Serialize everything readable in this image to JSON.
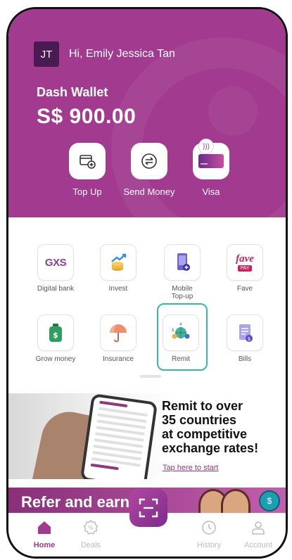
{
  "colors": {
    "brand": "#a23a8f",
    "accent_teal": "#39b8a1",
    "muted": "#bbbbbb"
  },
  "user": {
    "initials": "JT",
    "greeting": "Hi, Emily Jessica Tan"
  },
  "wallet": {
    "label": "Dash Wallet",
    "balance": "S$ 900.00"
  },
  "quick_actions": [
    {
      "label": "Top Up",
      "icon": "top-up-icon"
    },
    {
      "label": "Send Money",
      "icon": "send-money-icon"
    },
    {
      "label": "Visa",
      "icon": "visa-card-icon"
    }
  ],
  "services": [
    {
      "label": "Digital bank",
      "icon": "gxs-logo-icon",
      "logo_text": "GXS"
    },
    {
      "label": "Invest",
      "icon": "invest-icon"
    },
    {
      "label": "Mobile Top-up",
      "icon": "mobile-topup-icon"
    },
    {
      "label": "Fave",
      "icon": "fave-logo-icon",
      "logo_text": "fave",
      "logo_sub": "PAY"
    },
    {
      "label": "Grow money",
      "icon": "grow-money-icon"
    },
    {
      "label": "Insurance",
      "icon": "umbrella-icon"
    },
    {
      "label": "Remit",
      "icon": "remit-globe-icon"
    },
    {
      "label": "Bills",
      "icon": "bills-icon"
    }
  ],
  "banner": {
    "headline": [
      "Remit to over",
      "35 countries",
      "at competitive",
      "exchange rates!"
    ],
    "link": "Tap here to start"
  },
  "refer": {
    "title": "Refer and earn"
  },
  "nav": [
    {
      "label": "Home",
      "icon": "home-icon",
      "active": true
    },
    {
      "label": "Deals",
      "icon": "deals-icon"
    },
    {
      "label": "History",
      "icon": "history-clock-icon"
    },
    {
      "label": "Account",
      "icon": "account-icon"
    }
  ]
}
